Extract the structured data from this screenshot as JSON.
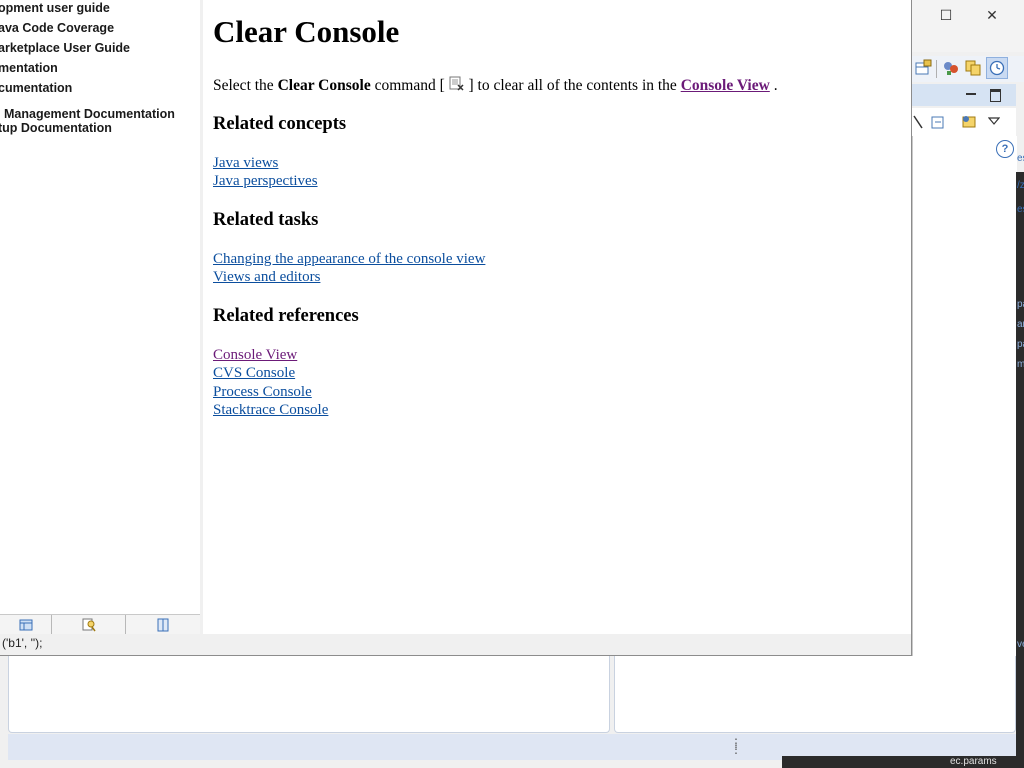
{
  "toc": {
    "items": [
      "opment user guide",
      "ava Code Coverage",
      "arketplace User Guide",
      "mentation",
      "cumentation",
      "Management Documentation",
      "tup Documentation"
    ]
  },
  "status": {
    "text": "('b1', '');"
  },
  "content": {
    "title": "Clear Console",
    "desc": {
      "pre": "Select the ",
      "bold": "Clear Console",
      "mid": " command [ ",
      "post": " ] to clear all of the contents in the ",
      "link": "Console View",
      "end": " ."
    },
    "sections": [
      {
        "heading": "Related concepts",
        "links": [
          {
            "label": "Java views",
            "visited": false
          },
          {
            "label": "Java perspectives",
            "visited": false
          }
        ]
      },
      {
        "heading": "Related tasks",
        "links": [
          {
            "label": "Changing the appearance of the console view",
            "visited": false
          },
          {
            "label": "Views and editors",
            "visited": false
          }
        ]
      },
      {
        "heading": "Related references",
        "links": [
          {
            "label": "Console View",
            "visited": true
          },
          {
            "label": "CVS Console",
            "visited": false
          },
          {
            "label": "Process Console",
            "visited": false
          },
          {
            "label": "Stacktrace Console",
            "visited": false
          }
        ]
      }
    ]
  },
  "ide": {
    "window_buttons": {
      "maximize": "☐",
      "close": "✕"
    },
    "help_symbol": "?",
    "bottom_file": "ec.params",
    "clipped": [
      "es",
      "/z",
      "es",
      "pa",
      "an",
      "pa",
      "m",
      "ve"
    ]
  },
  "icons": {
    "clear_console": "clear-console-icon",
    "toc_tabs": [
      "contents-icon",
      "search-icon",
      "bookmarks-icon"
    ]
  },
  "colors": {
    "link": "#0b4e9e",
    "visited_link": "#6b1a78",
    "status_bar": "#dfe6f3",
    "view_header": "#d6e3f3"
  }
}
